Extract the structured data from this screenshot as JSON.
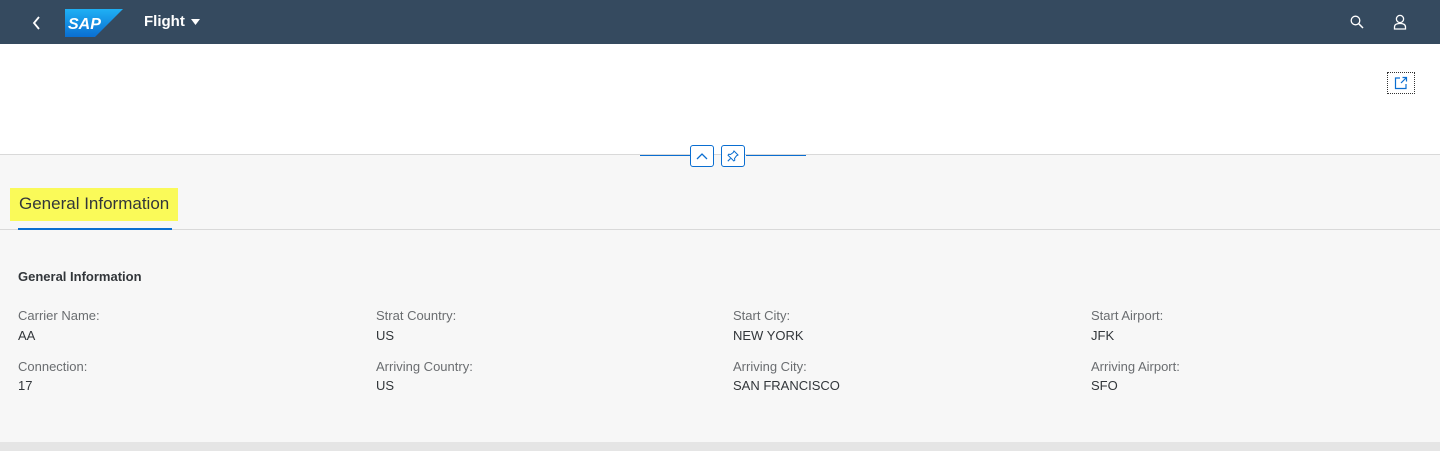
{
  "shell": {
    "title": "Flight",
    "logo_text": "SAP",
    "icons": [
      "back-icon",
      "search-icon",
      "user-icon"
    ]
  },
  "header": {
    "actions": [
      "share-icon",
      "collapse-icon",
      "pin-icon"
    ]
  },
  "anchor_bar": {
    "tabs": [
      {
        "label": "General Information",
        "selected": true
      }
    ]
  },
  "section": {
    "title": "General Information",
    "fields": [
      {
        "label": "Carrier Name:",
        "value": "AA"
      },
      {
        "label": "Strat Country:",
        "value": "US"
      },
      {
        "label": "Start City:",
        "value": "NEW YORK"
      },
      {
        "label": "Start Airport:",
        "value": "JFK"
      },
      {
        "label": "Connection:",
        "value": "17"
      },
      {
        "label": "Arriving Country:",
        "value": "US"
      },
      {
        "label": "Arriving City:",
        "value": "SAN FRANCISCO"
      },
      {
        "label": "Arriving Airport:",
        "value": "SFO"
      }
    ]
  },
  "colors": {
    "shell_bg": "#354a5f",
    "accent": "#0a6ed1",
    "highlight": "#fafa59",
    "page_bg": "#f7f7f7"
  }
}
